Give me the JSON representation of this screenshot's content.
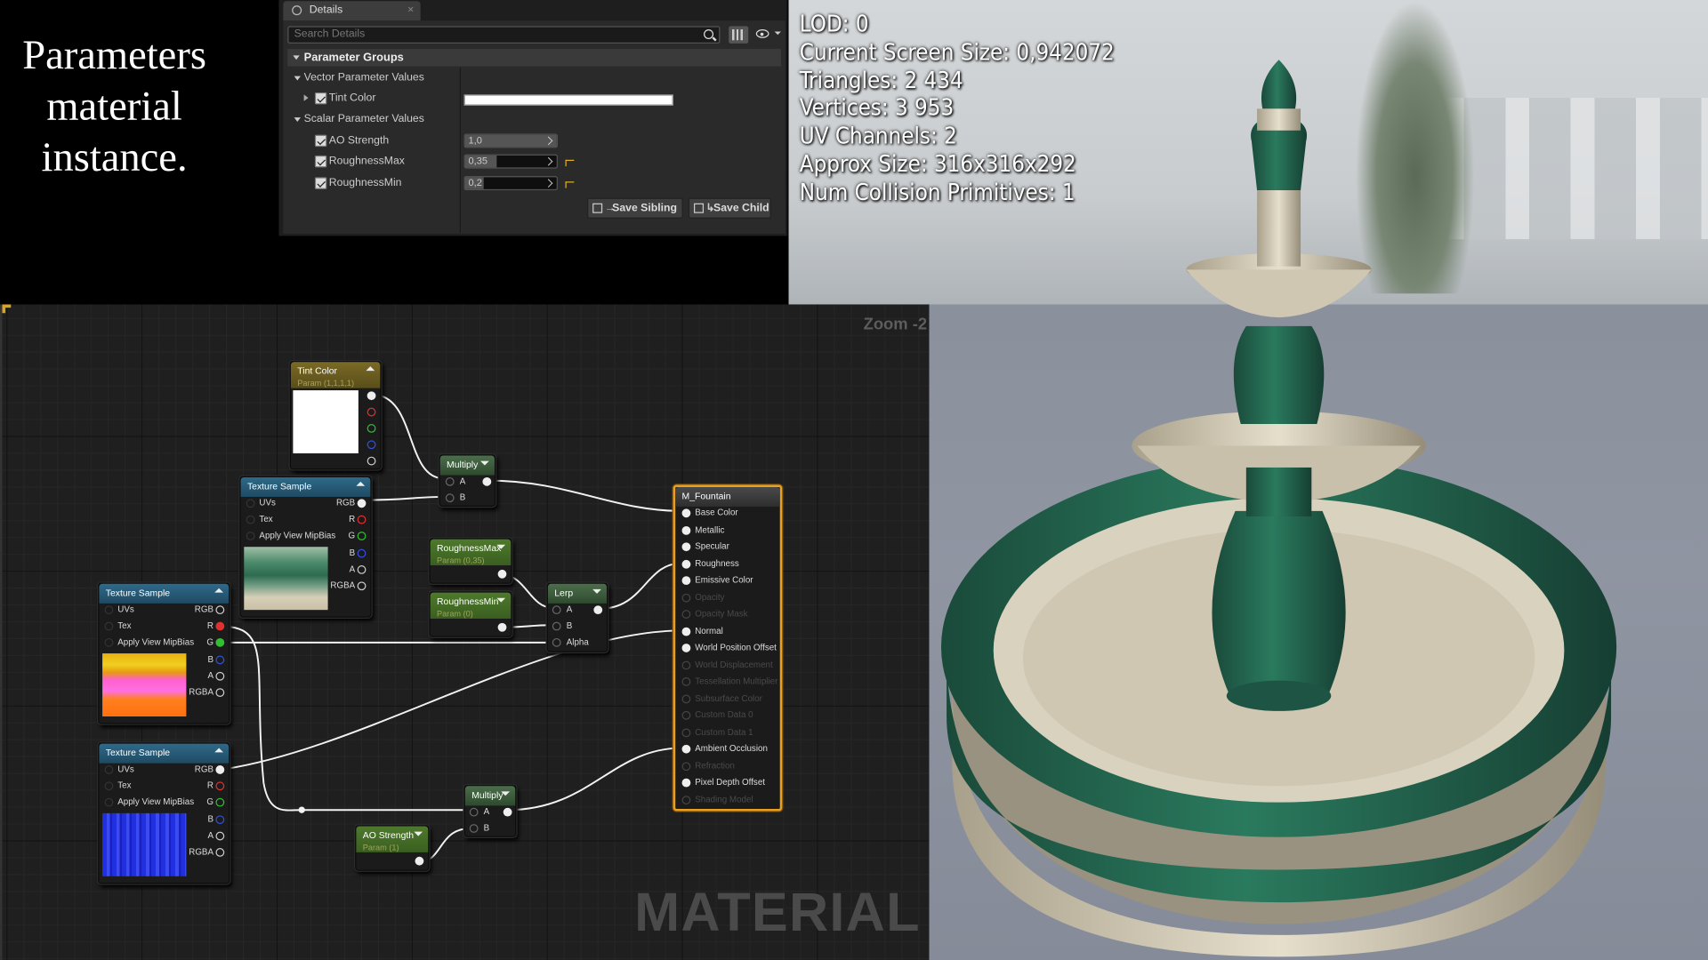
{
  "title_lines": [
    "Parameters",
    "material",
    "instance."
  ],
  "details": {
    "tab_label": "Details",
    "tab_close": "×",
    "search_placeholder": "Search Details",
    "group_header": "Parameter Groups",
    "vector_group": "Vector Parameter Values",
    "scalar_group": "Scalar Parameter Values",
    "params": [
      {
        "name": "Tint Color",
        "type": "color",
        "value": "#FFFFFF",
        "checked": true
      },
      {
        "name": "AO Strength",
        "value": "1,0",
        "checked": true,
        "fill_fraction": 1.0
      },
      {
        "name": "RoughnessMax",
        "value": "0,35",
        "checked": true,
        "fill_fraction": 0.35
      },
      {
        "name": "RoughnessMin",
        "value": "0,2",
        "checked": true,
        "fill_fraction": 0.2
      }
    ],
    "save_sibling": "Save Sibling",
    "save_child": "Save Child"
  },
  "stats": [
    "LOD:  0",
    "Current Screen Size:  0,942072",
    "Triangles:  2 434",
    "Vertices:  3 953",
    "UV Channels:  2",
    "Approx Size: 316x316x292",
    "Num Collision Primitives:  1"
  ],
  "graph": {
    "zoom": "Zoom -2",
    "watermark": "MATERIAL",
    "tint_color": {
      "title": "Tint Color",
      "subtitle": "Param (1,1,1,1)"
    },
    "multiply": "Multiply",
    "pin_a": "A",
    "pin_b": "B",
    "pin_alpha": "Alpha",
    "lerp": "Lerp",
    "texture_sample": "Texture Sample",
    "pins_left": [
      "UVs",
      "Tex",
      "Apply View MipBias"
    ],
    "pins_right": [
      "RGB",
      "R",
      "G",
      "B",
      "A",
      "RGBA"
    ],
    "roughness_max": {
      "title": "RoughnessMax",
      "subtitle": "Param (0,35)"
    },
    "roughness_min": {
      "title": "RoughnessMin",
      "subtitle": "Param (0)"
    },
    "ao_strength": {
      "title": "AO Strength",
      "subtitle": "Param (1)"
    },
    "main_node": {
      "title": "M_Fountain",
      "inputs": [
        {
          "label": "Base Color",
          "active": true
        },
        {
          "label": "Metallic",
          "active": true
        },
        {
          "label": "Specular",
          "active": true
        },
        {
          "label": "Roughness",
          "active": true
        },
        {
          "label": "Emissive Color",
          "active": true
        },
        {
          "label": "Opacity",
          "active": false
        },
        {
          "label": "Opacity Mask",
          "active": false
        },
        {
          "label": "Normal",
          "active": true
        },
        {
          "label": "World Position Offset",
          "active": true
        },
        {
          "label": "World Displacement",
          "active": false
        },
        {
          "label": "Tessellation Multiplier",
          "active": false
        },
        {
          "label": "Subsurface Color",
          "active": false
        },
        {
          "label": "Custom Data 0",
          "active": false
        },
        {
          "label": "Custom Data 1",
          "active": false
        },
        {
          "label": "Ambient Occlusion",
          "active": true
        },
        {
          "label": "Refraction",
          "active": false
        },
        {
          "label": "Pixel Depth Offset",
          "active": true
        },
        {
          "label": "Shading Model",
          "active": false
        }
      ]
    }
  },
  "colors": {
    "pin_red": "#e03030",
    "pin_green": "#30c030",
    "pin_blue": "#3050e0",
    "selected_border": "#e8a020",
    "param_header": "#5a7a2a",
    "texture_header": "#2a5a7a",
    "multiply_header": "#3a5a3a"
  }
}
